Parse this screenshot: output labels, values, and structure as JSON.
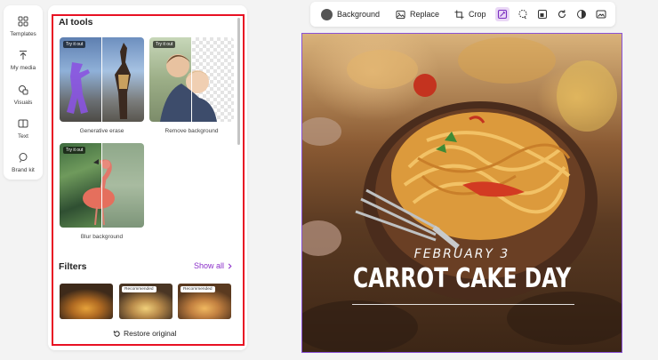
{
  "rail": {
    "items": [
      {
        "label": "Templates",
        "icon": "templates-icon"
      },
      {
        "label": "My media",
        "icon": "upload-icon"
      },
      {
        "label": "Visuals",
        "icon": "visuals-icon"
      },
      {
        "label": "Text",
        "icon": "text-icon"
      },
      {
        "label": "Brand kit",
        "icon": "brand-kit-icon"
      }
    ]
  },
  "panel": {
    "ai_title": "AI tools",
    "ai_tools": [
      {
        "label": "Generative erase",
        "tag": "Try it out"
      },
      {
        "label": "Remove background",
        "tag": "Try it out"
      },
      {
        "label": "Blur background",
        "tag": "Try it out"
      }
    ],
    "filters_title": "Filters",
    "show_all": "Show all",
    "filter_tags": [
      "",
      "Recommended",
      "Recommended"
    ],
    "restore": "Restore original"
  },
  "toolbar": {
    "background": "Background",
    "replace": "Replace",
    "crop": "Crop"
  },
  "canvas": {
    "date": "FEBRUARY 3",
    "title": "CARROT CAKE DAY"
  },
  "colors": {
    "accent": "#8b2fc9",
    "highlight_frame": "#e81123",
    "selection_border": "#8a52d6"
  }
}
